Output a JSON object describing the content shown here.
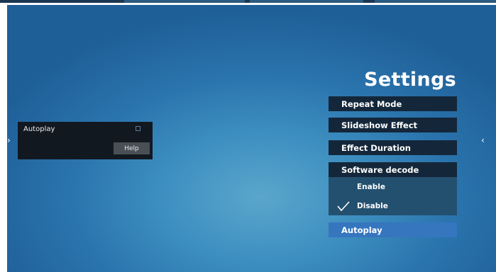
{
  "popup": {
    "title": "Autoplay",
    "help_label": "Help"
  },
  "settings": {
    "title": "Settings",
    "items": [
      {
        "label": "Repeat Mode"
      },
      {
        "label": "Slideshow Effect"
      },
      {
        "label": "Effect Duration"
      },
      {
        "label": "Software decode"
      },
      {
        "label": "Autoplay"
      }
    ],
    "software_decode_options": [
      {
        "label": "Enable",
        "checked": false
      },
      {
        "label": "Disable",
        "checked": true
      }
    ]
  },
  "nav": {
    "left_arrow": "›",
    "right_arrow": "‹"
  },
  "colors": {
    "menu_bg": "#14273a",
    "selected_bg": "#3576bf",
    "submenu_bg": "#24506f",
    "popup_bg": "#121820"
  }
}
